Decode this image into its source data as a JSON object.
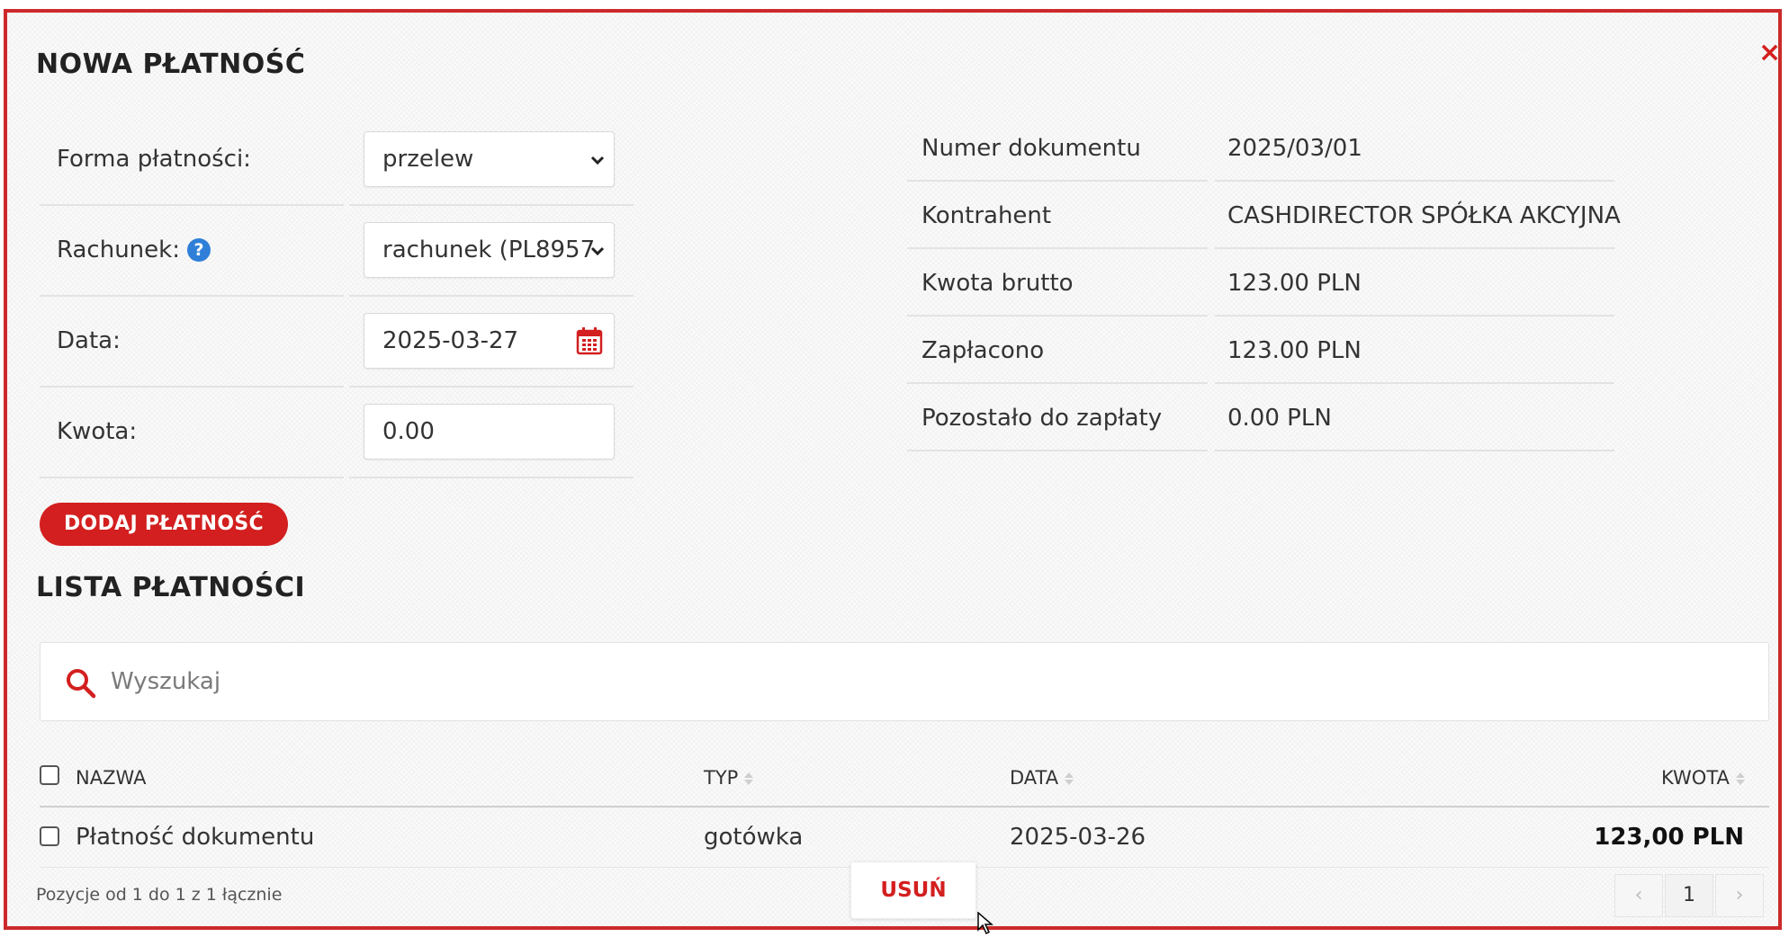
{
  "modal": {
    "title": "NOWA PŁATNOŚĆ",
    "close_label": "×"
  },
  "form": {
    "payment_form_label": "Forma płatności:",
    "payment_form_value": "przelew",
    "account_label": "Rachunek:",
    "account_help": "?",
    "account_value": "rachunek (PL8957",
    "date_label": "Data:",
    "date_value": "2025-03-27",
    "amount_label": "Kwota:",
    "amount_value": "0.00",
    "add_button": "DODAJ PŁATNOŚĆ"
  },
  "document_info": [
    {
      "label": "Numer dokumentu",
      "value": "2025/03/01"
    },
    {
      "label": "Kontrahent",
      "value": "CASHDIRECTOR SPÓŁKA AKCYJNA"
    },
    {
      "label": "Kwota brutto",
      "value": "123.00 PLN"
    },
    {
      "label": "Zapłacono",
      "value": "123.00 PLN"
    },
    {
      "label": "Pozostało do zapłaty",
      "value": "0.00 PLN"
    }
  ],
  "list": {
    "title": "LISTA PŁATNOŚCI",
    "search_placeholder": "Wyszukaj",
    "columns": {
      "name": "NAZWA",
      "type": "TYP",
      "date": "DATA",
      "amount": "KWOTA"
    },
    "rows": [
      {
        "name": "Płatność dokumentu",
        "type": "gotówka",
        "date": "2025-03-26",
        "amount": "123,00 PLN"
      }
    ],
    "footer_info": "Pozycje od 1 do 1 z 1 łącznie",
    "delete_button": "USUŃ",
    "pagination": {
      "prev": "‹",
      "current": "1",
      "next": "›"
    }
  },
  "colors": {
    "accent": "#d31f1f",
    "help_icon": "#2f7fd8"
  },
  "icons": {
    "close": "close-icon",
    "help": "question-circle-icon",
    "calendar": "calendar-icon",
    "search": "search-icon",
    "dropdown": "chevron-down-icon",
    "sort": "sort-icon"
  }
}
